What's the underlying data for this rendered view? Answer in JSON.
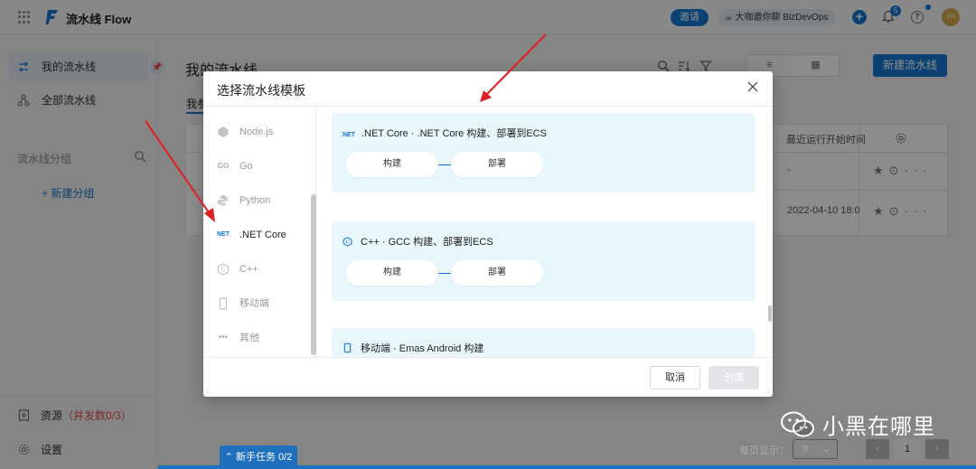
{
  "topbar": {
    "app_title": "流水线 Flow",
    "invite_label": "邀请",
    "promo_text": "☕ 大咖邀你聊 BizDevOps",
    "notification_count": "5",
    "avatar_initials": "XH",
    "icons": [
      "apps-grid-icon",
      "flow-logo-icon",
      "plus-circle-icon",
      "bell-icon",
      "help-icon"
    ]
  },
  "sidebar": {
    "items": [
      {
        "label": "我的流水线",
        "icon": "pipeline-icon",
        "active": true
      },
      {
        "label": "全部流水线",
        "icon": "branch-icon",
        "active": false
      }
    ],
    "group_title": "流水线分组",
    "new_group": "+ 新建分组",
    "resources_label": "资源",
    "resources_count": "（并发数0/3）",
    "settings_label": "设置"
  },
  "main": {
    "title": "我的流水线",
    "tab_label": "我参",
    "new_pipeline_label": "新建流水线",
    "table": {
      "last_run_header": "最近运行开始时间",
      "rows": [
        {
          "last_run": "-"
        },
        {
          "last_run": "2022-04-10 18:0"
        }
      ]
    }
  },
  "modal": {
    "title": "选择流水线模板",
    "languages": [
      {
        "label": "Node.js",
        "icon": "nodejs-icon",
        "active": false
      },
      {
        "label": "Go",
        "icon": "go-icon",
        "active": false
      },
      {
        "label": "Python",
        "icon": "python-icon",
        "active": false
      },
      {
        "label": ".NET Core",
        "icon": "dotnet-icon",
        "active": true
      },
      {
        "label": "C++",
        "icon": "cpp-icon",
        "active": false
      },
      {
        "label": "移动端",
        "icon": "mobile-icon",
        "active": false
      },
      {
        "label": "其他",
        "icon": "more-icon",
        "active": false
      }
    ],
    "templates": [
      {
        "title": ".NET Core · .NET Core 构建、部署到ECS",
        "icon": "dotnet-icon",
        "stages": [
          "构建",
          "部署"
        ]
      },
      {
        "title": "C++ · GCC 构建、部署到ECS",
        "icon": "cpp-icon",
        "stages": [
          "构建",
          "部署"
        ]
      },
      {
        "title": "移动端 · Emas Android 构建",
        "icon": "mobile-icon",
        "stages": []
      }
    ],
    "cancel_label": "取消",
    "create_label": "创建"
  },
  "pager": {
    "per_page_label": "每页显示：",
    "per_page_value": "8",
    "current_page": "1"
  },
  "tasks_tab": "新手任务 0/2",
  "watermark": "小黑在哪里",
  "colors": {
    "accent": "#1677d2",
    "card_bg": "#e8f7fc",
    "arrow": "#e02020"
  }
}
